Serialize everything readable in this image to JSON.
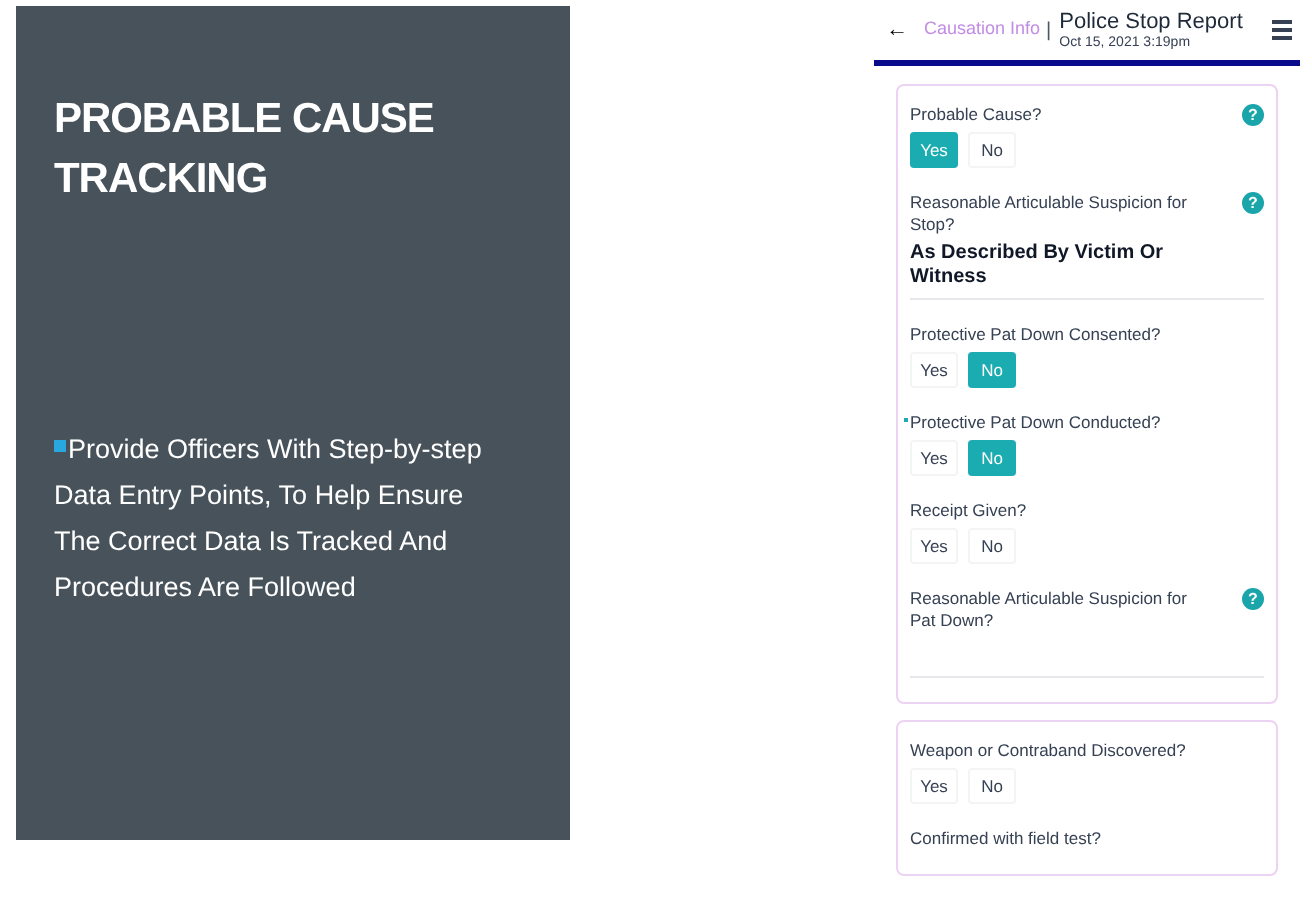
{
  "slide": {
    "title": "PROBABLE CAUSE TRACKING",
    "bullets": [
      "Provide Officers With Step-by-step Data Entry Points, To Help Ensure The Correct Data Is Tracked And Procedures Are Followed"
    ]
  },
  "app": {
    "header": {
      "back": "←",
      "section": "Causation Info",
      "separator": "|",
      "title": "Police Stop Report",
      "date": "Oct 15, 2021 3:19pm"
    },
    "cards": [
      {
        "questions": [
          {
            "kind": "choice",
            "label": "Probable Cause?",
            "help": "?",
            "flagged": false,
            "options": [
              {
                "label": "Yes",
                "selected": true
              },
              {
                "label": "No",
                "selected": false
              }
            ]
          },
          {
            "kind": "text",
            "label": "Reasonable Articulable Suspicion for Stop?",
            "help": "?",
            "flagged": false,
            "value": "As Described By Victim Or Witness"
          },
          {
            "kind": "choice",
            "label": "Protective Pat Down Consented?",
            "flagged": false,
            "options": [
              {
                "label": "Yes",
                "selected": false
              },
              {
                "label": "No",
                "selected": true
              }
            ]
          },
          {
            "kind": "choice",
            "label": "Protective Pat Down Conducted?",
            "flagged": true,
            "options": [
              {
                "label": "Yes",
                "selected": false
              },
              {
                "label": "No",
                "selected": true
              }
            ]
          },
          {
            "kind": "choice",
            "label": "Receipt Given?",
            "flagged": false,
            "options": [
              {
                "label": "Yes",
                "selected": false
              },
              {
                "label": "No",
                "selected": false
              }
            ]
          },
          {
            "kind": "text",
            "label": "Reasonable Articulable Suspicion for Pat Down?",
            "help": "?",
            "flagged": false
          }
        ]
      },
      {
        "questions": [
          {
            "kind": "choice",
            "label": "Weapon or Contraband Discovered?",
            "flagged": false,
            "options": [
              {
                "label": "Yes",
                "selected": false
              },
              {
                "label": "No",
                "selected": false
              }
            ]
          },
          {
            "kind": "label",
            "label": "Confirmed with field test?",
            "flagged": false
          }
        ]
      }
    ]
  }
}
